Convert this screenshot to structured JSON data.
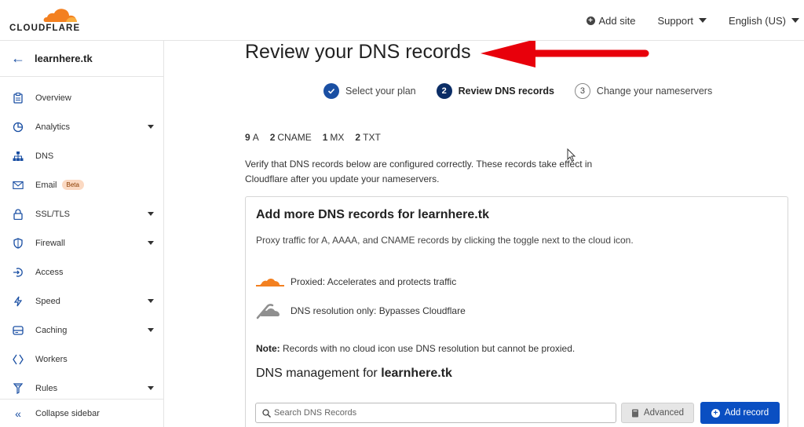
{
  "header": {
    "logo_text": "CLOUDFLARE",
    "add_site": "Add site",
    "support": "Support",
    "language": "English (US)"
  },
  "sidebar": {
    "site_name": "learnhere.tk",
    "items": [
      {
        "label": "Overview",
        "icon": "clipboard-icon"
      },
      {
        "label": "Analytics",
        "icon": "pie-chart-icon",
        "caret": true
      },
      {
        "label": "DNS",
        "icon": "network-icon"
      },
      {
        "label": "Email",
        "icon": "email-icon",
        "badge": "Beta"
      },
      {
        "label": "SSL/TLS",
        "icon": "lock-icon",
        "caret": true
      },
      {
        "label": "Firewall",
        "icon": "shield-icon",
        "caret": true
      },
      {
        "label": "Access",
        "icon": "access-icon"
      },
      {
        "label": "Speed",
        "icon": "lightning-icon",
        "caret": true
      },
      {
        "label": "Caching",
        "icon": "server-icon",
        "caret": true
      },
      {
        "label": "Workers",
        "icon": "workers-icon"
      },
      {
        "label": "Rules",
        "icon": "funnel-icon",
        "caret": true
      }
    ],
    "collapse": "Collapse sidebar"
  },
  "main": {
    "title": "Review your DNS records",
    "steps": [
      {
        "number": "",
        "label": "Select your plan",
        "state": "done"
      },
      {
        "number": "2",
        "label": "Review DNS records",
        "state": "active"
      },
      {
        "number": "3",
        "label": "Change your nameservers",
        "state": "todo"
      }
    ],
    "counts": [
      {
        "n": "9",
        "type": "A"
      },
      {
        "n": "2",
        "type": "CNAME"
      },
      {
        "n": "1",
        "type": "MX"
      },
      {
        "n": "2",
        "type": "TXT"
      }
    ],
    "verify_text": "Verify that DNS records below are configured correctly. These records take effect in Cloudflare after you update your nameservers.",
    "card": {
      "title": "Add more DNS records for learnhere.tk",
      "desc": "Proxy traffic for A, AAAA, and CNAME records by clicking the toggle next to the cloud icon.",
      "proxied": "Proxied: Accelerates and protects traffic",
      "dns_only": "DNS resolution only: Bypasses Cloudflare",
      "note_label": "Note:",
      "note_text": "Records with no cloud icon use DNS resolution but cannot be proxied.",
      "mgmt_prefix": "DNS management for",
      "mgmt_domain": "learnhere.tk",
      "search_placeholder": "Search DNS Records",
      "advanced": "Advanced",
      "add_record": "Add record"
    }
  },
  "colors": {
    "accent": "#0a4fc2",
    "cloudflare_orange": "#f38020",
    "annotation_red": "#e8000b"
  }
}
